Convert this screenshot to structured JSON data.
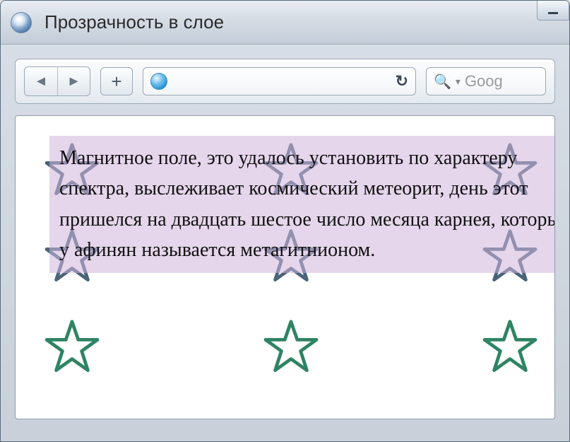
{
  "window": {
    "title": "Прозрачность в слое"
  },
  "toolbar": {
    "newtab_label": "+",
    "reload_glyph": "↻"
  },
  "search": {
    "placeholder": "Goog"
  },
  "page": {
    "body_text": "Магнитное поле, это удалось установить по характеру спектра, выслеживает космический метеорит, день этот пришелся на двадцать шестое число месяца карнея, который у афинян называется метагитнионом."
  },
  "colors": {
    "overlay_bg": "rgba(208,180,220,0.55)",
    "star_top": "#4a6478",
    "star_bottom": "#2e8464"
  }
}
